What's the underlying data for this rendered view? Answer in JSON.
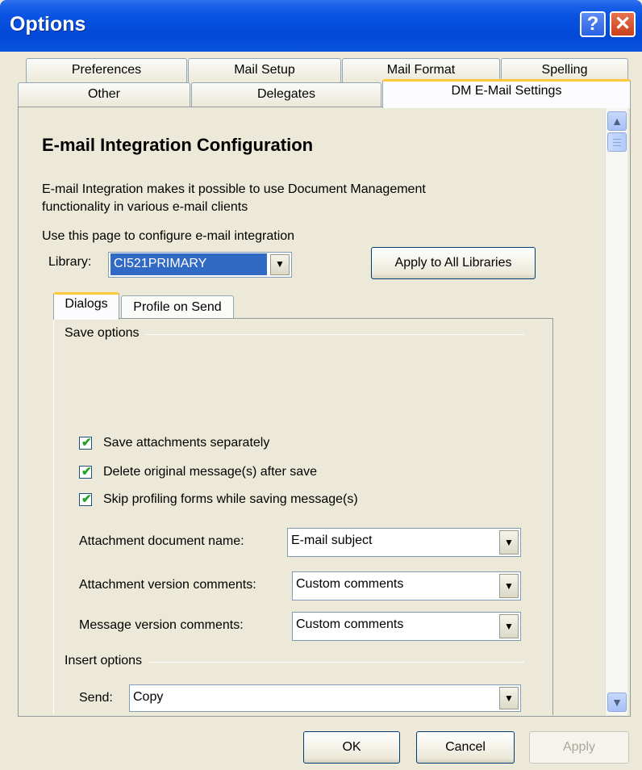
{
  "window": {
    "title": "Options",
    "help_label": "?",
    "close_label": "✕"
  },
  "tabs": {
    "row1": [
      "Preferences",
      "Mail Setup",
      "Mail Format",
      "Spelling"
    ],
    "row2": [
      "Other",
      "Delegates",
      "DM E-Mail Settings"
    ]
  },
  "content": {
    "heading": "E-mail Integration Configuration",
    "description_line1": "E-mail Integration makes it possible to use Document Management",
    "description_line2": "functionality in various e-mail clients",
    "instruction": "Use this page to configure e-mail integration",
    "library": {
      "label": "Library:",
      "value": "CI521PRIMARY"
    },
    "apply_all_label": "Apply to All Libraries",
    "inner_tabs": [
      "Dialogs",
      "Profile on Send"
    ],
    "save_options": {
      "group_label": "Save options",
      "checkboxes": [
        {
          "label": "Save attachments separately",
          "checked": true
        },
        {
          "label": "Delete original message(s) after save",
          "checked": true
        },
        {
          "label": "Skip profiling forms while saving message(s)",
          "checked": true
        }
      ],
      "fields": [
        {
          "label": "Attachment document name:",
          "value": "E-mail subject"
        },
        {
          "label": "Attachment version comments:",
          "value": "Custom comments"
        },
        {
          "label": "Message version comments:",
          "value": "Custom comments"
        }
      ]
    },
    "insert_options": {
      "group_label": "Insert options",
      "send_label": "Send:",
      "send_value": "Copy"
    }
  },
  "buttons": {
    "ok": "OK",
    "cancel": "Cancel",
    "apply": "Apply"
  },
  "colors": {
    "titlebar": "#0a54e3",
    "active_tab_accent": "#ffc83c",
    "selection": "#316ac5",
    "dialog_bg": "#ece9d8"
  }
}
